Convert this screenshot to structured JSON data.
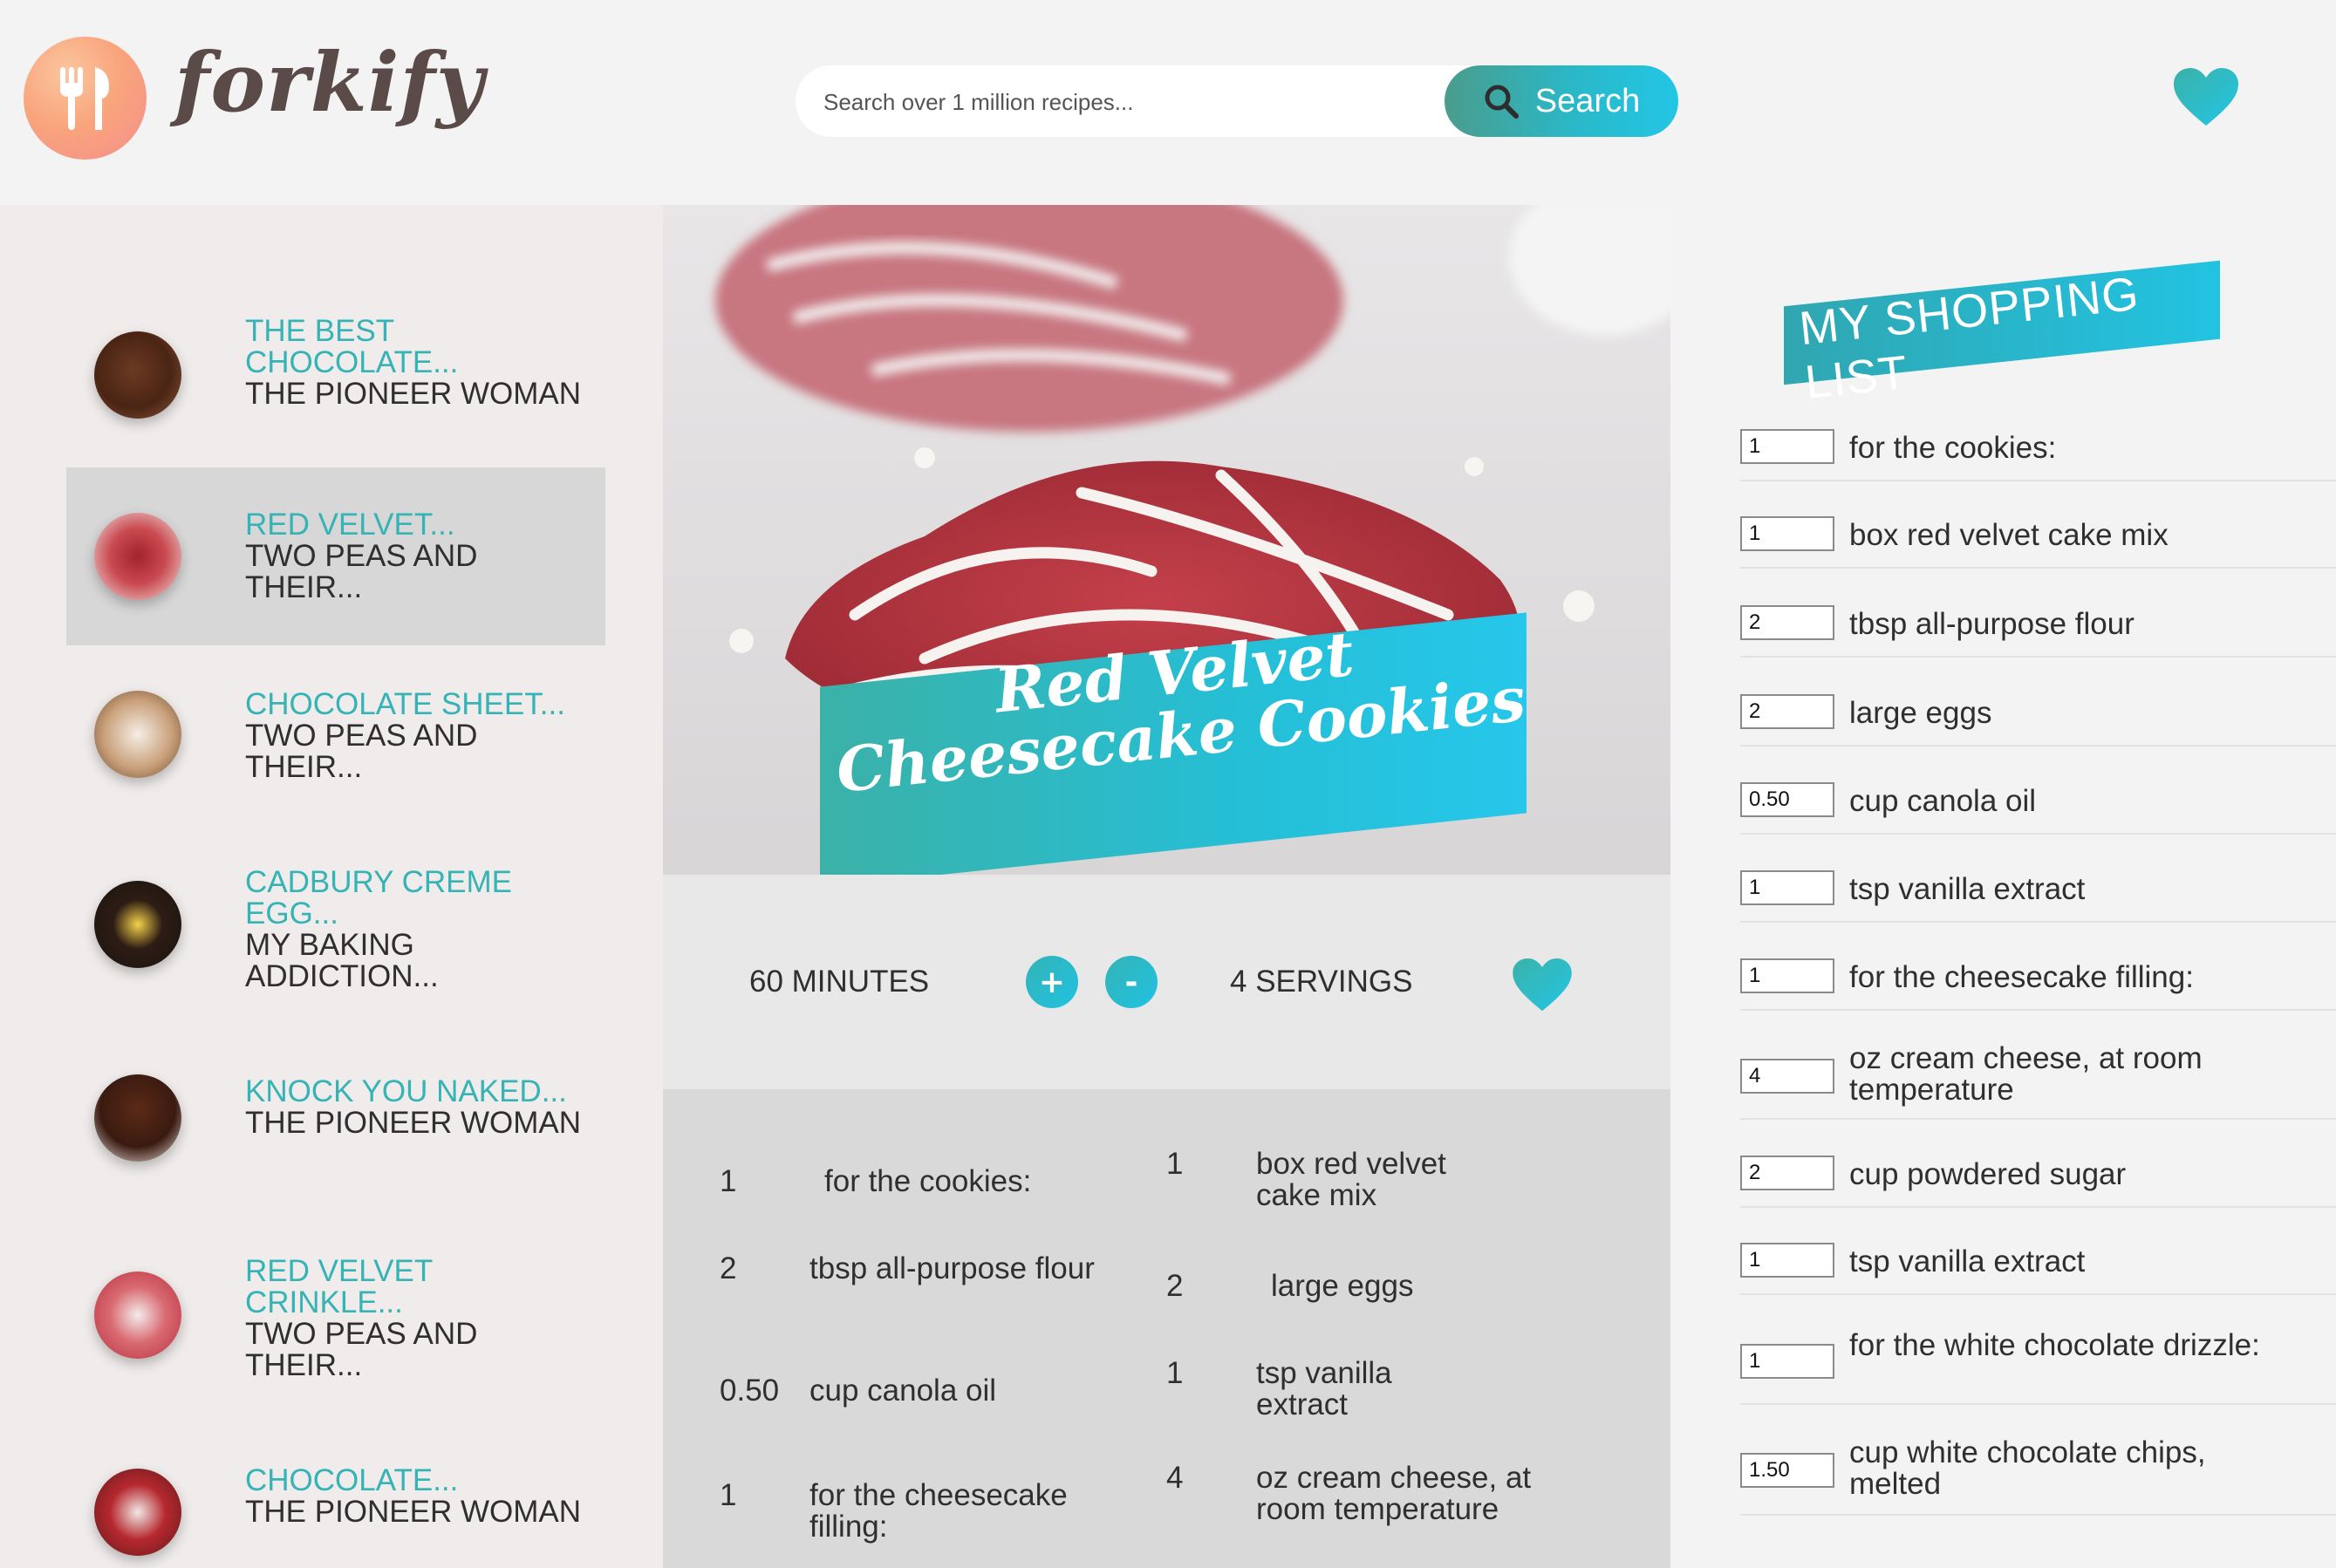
{
  "header": {
    "logo_text": "forkify",
    "search_placeholder": "Search over 1 million recipes...",
    "search_label": "Search"
  },
  "results": [
    {
      "title": "The best chocolate...",
      "publisher": "The pioneer woman"
    },
    {
      "title": "Red velvet...",
      "publisher": "Two peas and their..."
    },
    {
      "title": "Chocolate sheet...",
      "publisher": "Two peas and their..."
    },
    {
      "title": "Cadbury creme egg...",
      "publisher": "My baking addiction..."
    },
    {
      "title": "Knock you naked...",
      "publisher": "The pioneer woman"
    },
    {
      "title": "Red velvet crinkle...",
      "publisher": "Two peas and their..."
    },
    {
      "title": "Chocolate...",
      "publisher": "The pioneer woman"
    }
  ],
  "recipe": {
    "title": "Red Velvet Cheesecake Cookies",
    "time": "60 minutes",
    "servings": "4 servings",
    "plus_label": "+",
    "minus_label": "-",
    "ingredients": [
      {
        "count": "1",
        "desc": "for the cookies:"
      },
      {
        "count": "1",
        "desc": "box red velvet cake mix"
      },
      {
        "count": "2",
        "desc": "tbsp all-purpose flour"
      },
      {
        "count": "2",
        "desc": "large eggs"
      },
      {
        "count": "0.50",
        "desc": "cup canola oil"
      },
      {
        "count": "1",
        "desc": "tsp vanilla extract"
      },
      {
        "count": "1",
        "desc": "for the cheesecake filling:"
      },
      {
        "count": "4",
        "desc": "oz cream cheese, at room temperature"
      }
    ]
  },
  "shopping": {
    "title": "My shopping list",
    "items": [
      {
        "qty": "1",
        "desc": "for the cookies:"
      },
      {
        "qty": "1",
        "desc": "box red velvet cake mix"
      },
      {
        "qty": "2",
        "desc": "tbsp all-purpose flour"
      },
      {
        "qty": "2",
        "desc": "large eggs"
      },
      {
        "qty": "0.50",
        "desc": "cup canola oil"
      },
      {
        "qty": "1",
        "desc": "tsp vanilla extract"
      },
      {
        "qty": "1",
        "desc": "for the cheesecake filling:"
      },
      {
        "qty": "4",
        "desc": "oz cream cheese, at room temperature"
      },
      {
        "qty": "2",
        "desc": "cup powdered sugar"
      },
      {
        "qty": "1",
        "desc": "tsp vanilla extract"
      },
      {
        "qty": "1",
        "desc": "for the white chocolate drizzle:"
      },
      {
        "qty": "1.50",
        "desc": "cup white chocolate chips, melted"
      }
    ]
  },
  "colors": {
    "accent": "#2ec0d8",
    "accent_dark": "#3bb1a8",
    "link": "#36b3b5",
    "logo_start": "#fbc6a0",
    "logo_end": "#f58d8d"
  },
  "icons": {
    "logo": "fork-knife-icon",
    "search": "search-icon",
    "likes": "heart-icon"
  }
}
